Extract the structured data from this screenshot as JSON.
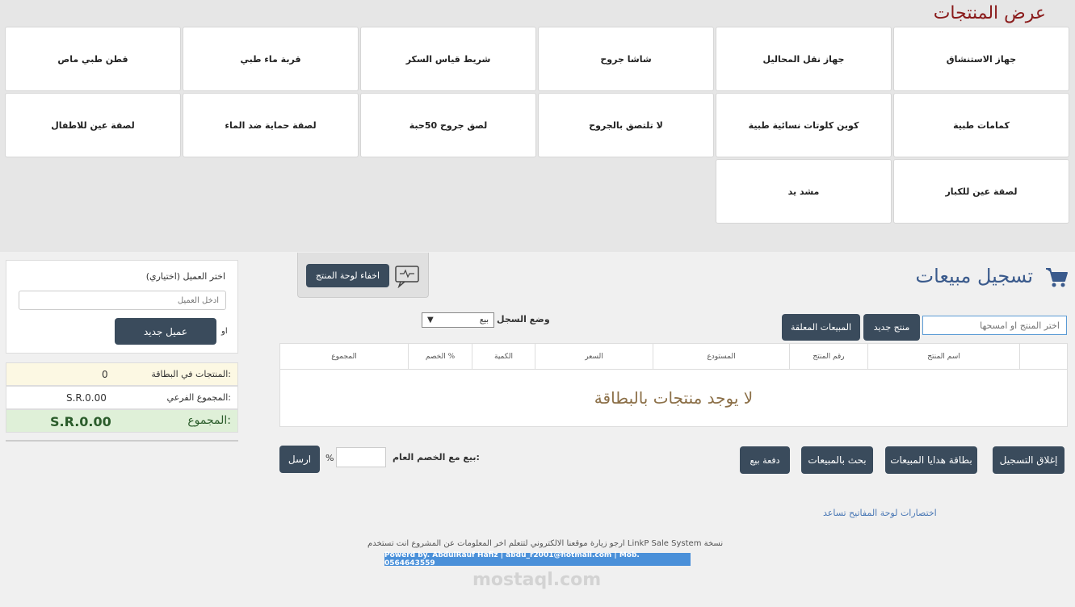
{
  "products_title": "عرض المنتجات",
  "products": [
    "جهاز الاستنشاق",
    "جهاز نقل المحاليل",
    "شاشا جروح",
    "شريط قياس السكر",
    "قربة ماء طبي",
    "قطن طبي ماص",
    "كمامات طبية",
    "كوين كلوتات نسائية طبية",
    "لا تلتصق بالجروح",
    "لصق جروح 50حبة",
    "لصقة حماية ضد الماء",
    "لصقة عين للاطفال",
    "لصقة عين للكبار",
    "مشد يد"
  ],
  "hide_panel_label": "اخفاء لوحة المنتج",
  "sales": {
    "title": "تسجيل مبيعات",
    "search_placeholder": "اختر المنتج او امسحها",
    "new_product": "منتج جديد",
    "suspended_sales": "المبيعات المعلقة",
    "mode_label": "وضع السجل",
    "mode_value": "بيع"
  },
  "table": {
    "columns": [
      "اسم المنتج",
      "رقم المنتج",
      "المستودع",
      "السعر",
      "الكمية",
      "الخصم %",
      "المجموع"
    ],
    "empty": "لا يوجد منتجات بالبطاقة"
  },
  "actions": {
    "close_register": "إغلاق التسجيل",
    "gift_card": "بطاقة هدايا المبيعات",
    "search_sales": "بحث بالمبيعات",
    "pay": "دفعة بيع",
    "discount_label": "بيع مع الخصم العام:",
    "percent": "%",
    "send": "ارسل"
  },
  "keyboard_link": "اختصارات لوحة المفاتيح تساعد",
  "footer": {
    "line": "ارجو زيارة موقعنا الالكتروني لتتعلم اخر المعلومات عن المشروع انت تستخدم LinkP Sale System نسخة",
    "badge": "Powerd by. AbdulRauf Hafiz | abdu_r2001@hotmail.com | Mob. 0564643559",
    "watermark": "mostaql.com"
  },
  "customer": {
    "label": "اختر العميل (اختياري)",
    "placeholder": "ادخل العميل",
    "or": "او",
    "new_customer": "عميل جديد"
  },
  "summary": {
    "items_label": "المنتجات في البطاقة:",
    "items_value": "0",
    "subtotal_label": "المجموع الفرعي:",
    "subtotal_value": "S.R.0.00",
    "total_label": "المجموع:",
    "total_value": "S.R.0.00"
  }
}
